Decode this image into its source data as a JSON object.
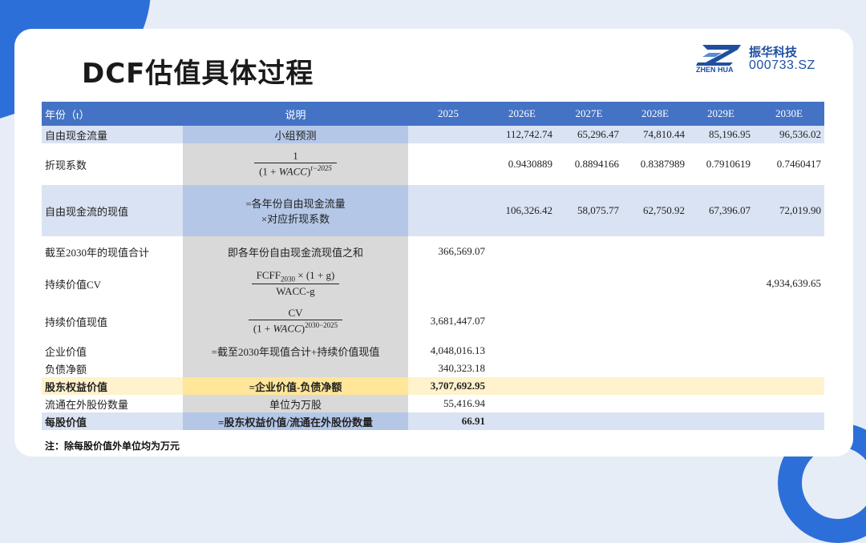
{
  "title": "DCF估值具体过程",
  "logo": {
    "cn": "振华科技",
    "en": "ZHEN HUA",
    "code": "000733.SZ"
  },
  "table": {
    "headers": [
      "年份（t）",
      "说明",
      "2025",
      "2026E",
      "2027E",
      "2028E",
      "2029E",
      "2030E"
    ],
    "rows": {
      "fcf": {
        "label": "自由现金流量",
        "desc": "小组预测",
        "vals": [
          "",
          "112,742.74",
          "65,296.47",
          "74,810.44",
          "85,196.95",
          "96,536.02"
        ]
      },
      "discount": {
        "label": "折现系数",
        "num": "1",
        "den_a": "(1 + ",
        "den_var": "WACC",
        "den_b": ")",
        "den_sup": "t−2025",
        "vals": [
          "",
          "0.9430889",
          "0.8894166",
          "0.8387989",
          "0.7910619",
          "0.7460417"
        ]
      },
      "pv": {
        "label": "自由现金流的现值",
        "desc1": "=各年份自由现金流量",
        "desc2": "×对应折现系数",
        "vals": [
          "",
          "106,326.42",
          "58,075.77",
          "62,750.92",
          "67,396.07",
          "72,019.90"
        ]
      },
      "sum_pv": {
        "label": "截至2030年的现值合计",
        "desc": "即各年份自由现金流现值之和",
        "v2025": "366,569.07"
      },
      "cv": {
        "label": "持续价值CV",
        "num_a": "FCFF",
        "num_sub": "2030",
        "num_b": " × (1 + g)",
        "den": "WACC-g",
        "v2030": "4,934,639.65"
      },
      "cv_pv": {
        "label": "持续价值现值",
        "num": "CV",
        "den_a": "(1 + ",
        "den_var": "WACC",
        "den_b": ")",
        "den_sup": "2030−2025",
        "v2025": "3,681,447.07"
      },
      "ev": {
        "label": "企业价值",
        "desc": "=截至2030年现值合计+持续价值现值",
        "v2025": "4,048,016.13"
      },
      "debt": {
        "label": "负债净额",
        "desc": "",
        "v2025": "340,323.18"
      },
      "equity": {
        "label": "股东权益价值",
        "desc": "=企业价值-负债净额",
        "v2025": "3,707,692.95"
      },
      "shares": {
        "label": "流通在外股份数量",
        "desc": "单位为万股",
        "v2025": "55,416.94"
      },
      "per_share": {
        "label": "每股价值",
        "desc": "=股东权益价值/流通在外股份数量",
        "v2025": "66.91"
      }
    }
  },
  "note": "注：除每股价值外单位均为万元",
  "colors": {
    "header_blue": "#4472c4",
    "light_blue": "#dae3f3",
    "highlight_yellow": "#fff2cc",
    "accent": "#2d6fd8"
  }
}
